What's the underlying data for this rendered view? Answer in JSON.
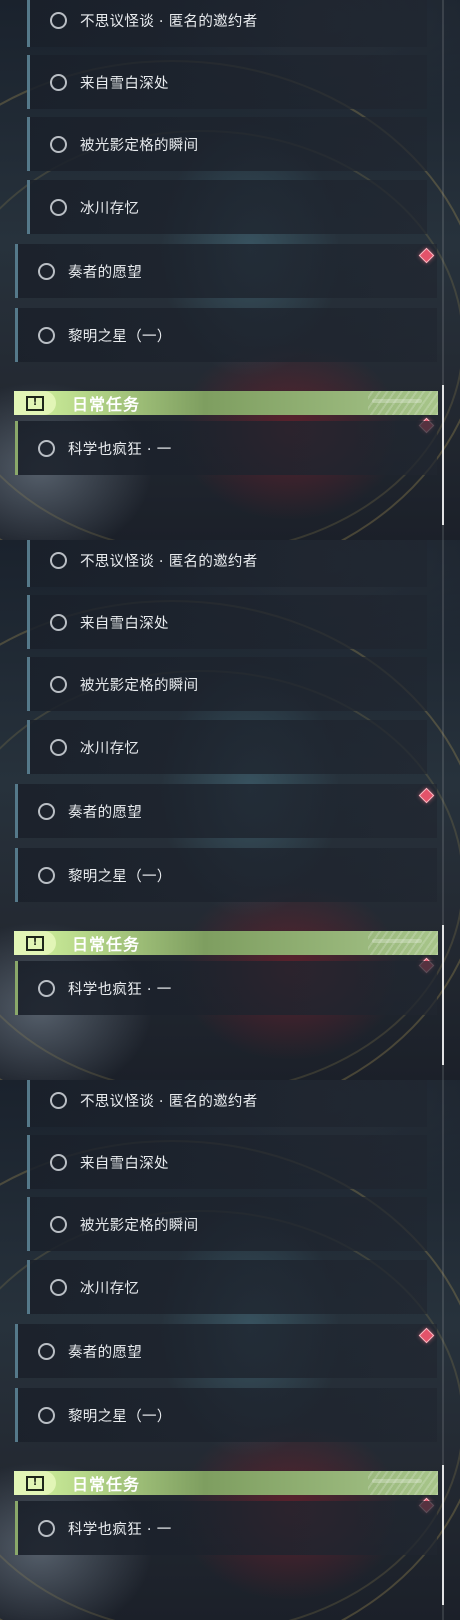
{
  "panels": [
    {
      "quests": [
        {
          "label": "不思议怪谈 · 匿名的邀约者"
        },
        {
          "label": "来自雪白深处"
        },
        {
          "label": "被光影定格的瞬间"
        },
        {
          "label": "冰川存忆"
        },
        {
          "label": "奏者的愿望"
        },
        {
          "label": "黎明之星（一）"
        }
      ],
      "section_title": "日常任务",
      "daily_quest": {
        "label": "科学也疯狂 · 一"
      }
    },
    {
      "quests": [
        {
          "label": "不思议怪谈 · 匿名的邀约者"
        },
        {
          "label": "来自雪白深处"
        },
        {
          "label": "被光影定格的瞬间"
        },
        {
          "label": "冰川存忆"
        },
        {
          "label": "奏者的愿望"
        },
        {
          "label": "黎明之星（一）"
        }
      ],
      "section_title": "日常任务",
      "daily_quest": {
        "label": "科学也疯狂 · 一"
      }
    },
    {
      "quests": [
        {
          "label": "不思议怪谈 · 匿名的邀约者"
        },
        {
          "label": "来自雪白深处"
        },
        {
          "label": "被光影定格的瞬间"
        },
        {
          "label": "冰川存忆"
        },
        {
          "label": "奏者的愿望"
        },
        {
          "label": "黎明之星（一）"
        }
      ],
      "section_title": "日常任务",
      "daily_quest": {
        "label": "科学也疯狂 · 一"
      }
    }
  ],
  "colors": {
    "row_accent": "#55798a",
    "daily_accent": "#8aa86a",
    "header_green": "#bfe090",
    "marker_red": "#e4536a"
  }
}
